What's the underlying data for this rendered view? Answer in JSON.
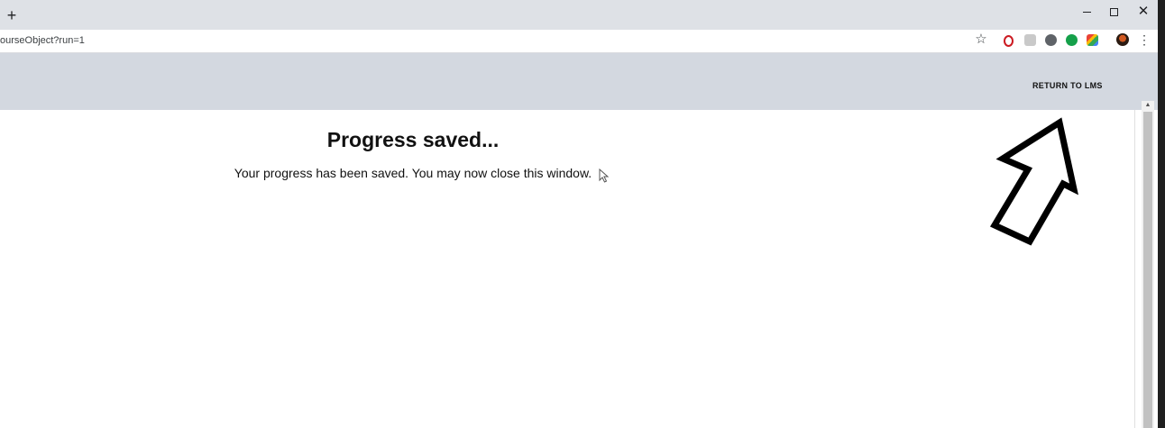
{
  "browser": {
    "new_tab_label": "+",
    "url": "ourseObject?run=1",
    "window_controls": {
      "close": "✕"
    },
    "star_icon": "☆",
    "menu_icon": "⋮",
    "extensions": [
      "opera-icon",
      "extension-grey-icon",
      "extension-gear-icon",
      "grammarly-icon",
      "extension-multicolor-icon"
    ]
  },
  "page": {
    "header_link": "RETURN TO LMS",
    "title": "Progress saved...",
    "message": "Your progress has been saved. You may now close this window."
  },
  "colors": {
    "tabstrip": "#dee1e6",
    "page_header": "#d3d8e0",
    "content_bg": "#ffffff",
    "text": "#111111"
  }
}
